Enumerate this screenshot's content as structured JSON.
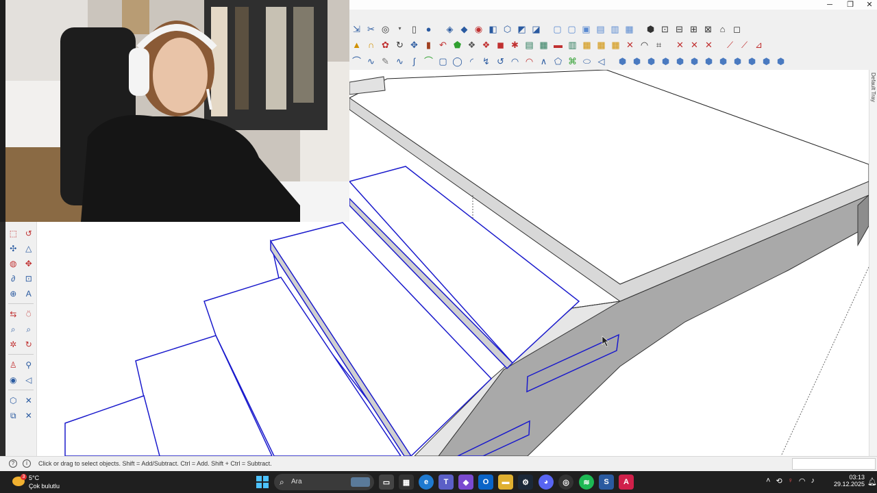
{
  "window": {
    "minimize": "─",
    "restore": "❐",
    "close": "✕"
  },
  "tray_tab": {
    "label": "Default Tray"
  },
  "statusbar": {
    "hint": "Click or drag to select objects. Shift = Add/Subtract. Ctrl = Add. Shift + Ctrl = Subtract.",
    "measurements_value": ""
  },
  "taskbar": {
    "weather": {
      "temp": "5°C",
      "desc": "Çok bulutlu",
      "badge": "3"
    },
    "search": {
      "placeholder": "Ara"
    },
    "clock": {
      "time": "03:13",
      "date": "29.12.2025"
    }
  },
  "colors": {
    "selection": "#1a1acc",
    "face_top": "#ffffff",
    "face_side": "#a9a9a9",
    "toolbar_bg": "#f0f0f0",
    "taskbar_bg": "#1f1f1f"
  },
  "icons": {
    "toolbar_row1": [
      "select-tool-icon",
      "lasso-icon",
      "zoom-extents-icon",
      "new-file-icon",
      "user-icon",
      "paint-icon",
      "component-icon",
      "section-plane-icon",
      "box-view-icon",
      "iso-view-icon",
      "top-view-icon",
      "front-view-icon",
      "right-view-icon",
      "back-view-icon",
      "left-view-icon",
      "xray-icon",
      "wireframe-icon",
      "hidden-line-icon",
      "shaded-icon",
      "textured-icon",
      "monochrome-icon",
      "house-icon",
      "tag-icon"
    ],
    "toolbar_row2": [
      "warning-icon",
      "magnet-icon",
      "follow-me-icon",
      "rotate-icon",
      "move-icon",
      "push-pull-icon",
      "undo-icon",
      "paint-bucket-icon",
      "solid-tools-icon",
      "outer-shell-icon",
      "intersect-icon",
      "union-icon",
      "subtract-icon",
      "trim-icon",
      "split-icon",
      "grid-icon",
      "grid-fill-icon",
      "explode-icon",
      "curve-icon",
      "weld-icon",
      "intersect-lines-icon",
      "extend-icon",
      "fillet-icon"
    ],
    "toolbar_row3": [
      "arc-icon",
      "freehand-icon",
      "bezier-icon",
      "spline-icon",
      "polyline-icon",
      "rectangle-icon",
      "circle-icon",
      "arc-2pt-icon",
      "pie-icon",
      "polygon-icon",
      "offset-icon",
      "tape-icon",
      "dimension-icon",
      "protractor-icon",
      "text-icon",
      "axes-icon",
      "orbit-icon",
      "pan-icon",
      "zoom-icon",
      "walk-icon"
    ]
  }
}
